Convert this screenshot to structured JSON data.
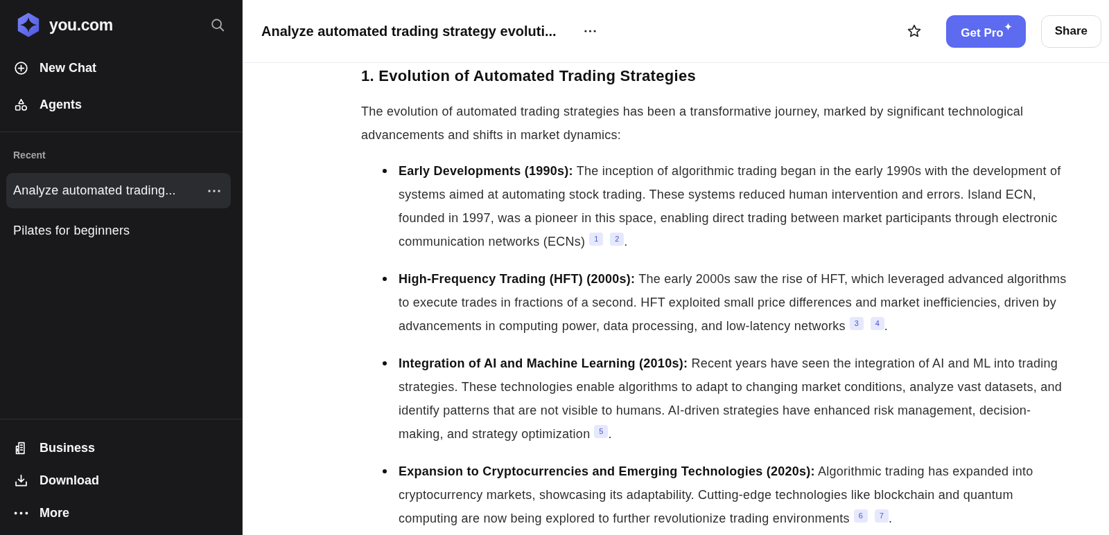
{
  "sidebar": {
    "brand": "you.com",
    "nav": [
      "New Chat",
      "Agents"
    ],
    "recent_heading": "Recent",
    "recent": [
      {
        "title": "Analyze automated trading...",
        "selected": true
      },
      {
        "title": "Pilates for beginners",
        "selected": false
      }
    ],
    "footer_nav": [
      "Business",
      "Download",
      "More"
    ]
  },
  "header": {
    "title": "Analyze automated trading strategy evoluti...",
    "actions": [
      {
        "label": "Get Pro",
        "kind": "primary"
      },
      {
        "label": "Share",
        "kind": "secondary"
      }
    ]
  },
  "article": {
    "heading": "1. Evolution of Automated Trading Strategies",
    "intro": "The evolution of automated trading strategies has been a transformative journey, marked by significant technological advancements and shifts in market dynamics:",
    "points": [
      {
        "text": "**Early Developments (1990s):** The inception of algorithmic trading began in the early 1990s with the development of systems aimed at automating stock trading. These systems reduced human intervention and errors. Island ECN, founded in 1997, was a pioneer in this space, enabling direct trading between market participants through electronic communication networks (ECNs)",
        "citations": [
          "1",
          "2"
        ],
        "end": "."
      },
      {
        "text": "**High-Frequency Trading (HFT) (2000s):** The early 2000s saw the rise of HFT, which leveraged advanced algorithms to execute trades in fractions of a second. HFT exploited small price differences and market inefficiencies, driven by advancements in computing power, data processing, and low-latency networks",
        "citations": [
          "3",
          "4"
        ],
        "end": "."
      },
      {
        "text": "**Integration of AI and Machine Learning (2010s):** Recent years have seen the integration of AI and ML into trading strategies. These technologies enable algorithms to adapt to changing market conditions, analyze vast datasets, and identify patterns that are not visible to humans. AI-driven strategies have enhanced risk management, decision-making, and strategy optimization",
        "citations": [
          "5"
        ],
        "end": "."
      },
      {
        "text": "**Expansion to Cryptocurrencies and Emerging Technologies (2020s):** Algorithmic trading has expanded into cryptocurrency markets, showcasing its adaptability. Cutting-edge technologies like blockchain and quantum computing are now being explored to further revolutionize trading environments",
        "citations": [
          "6",
          "7"
        ],
        "end": "."
      }
    ]
  }
}
